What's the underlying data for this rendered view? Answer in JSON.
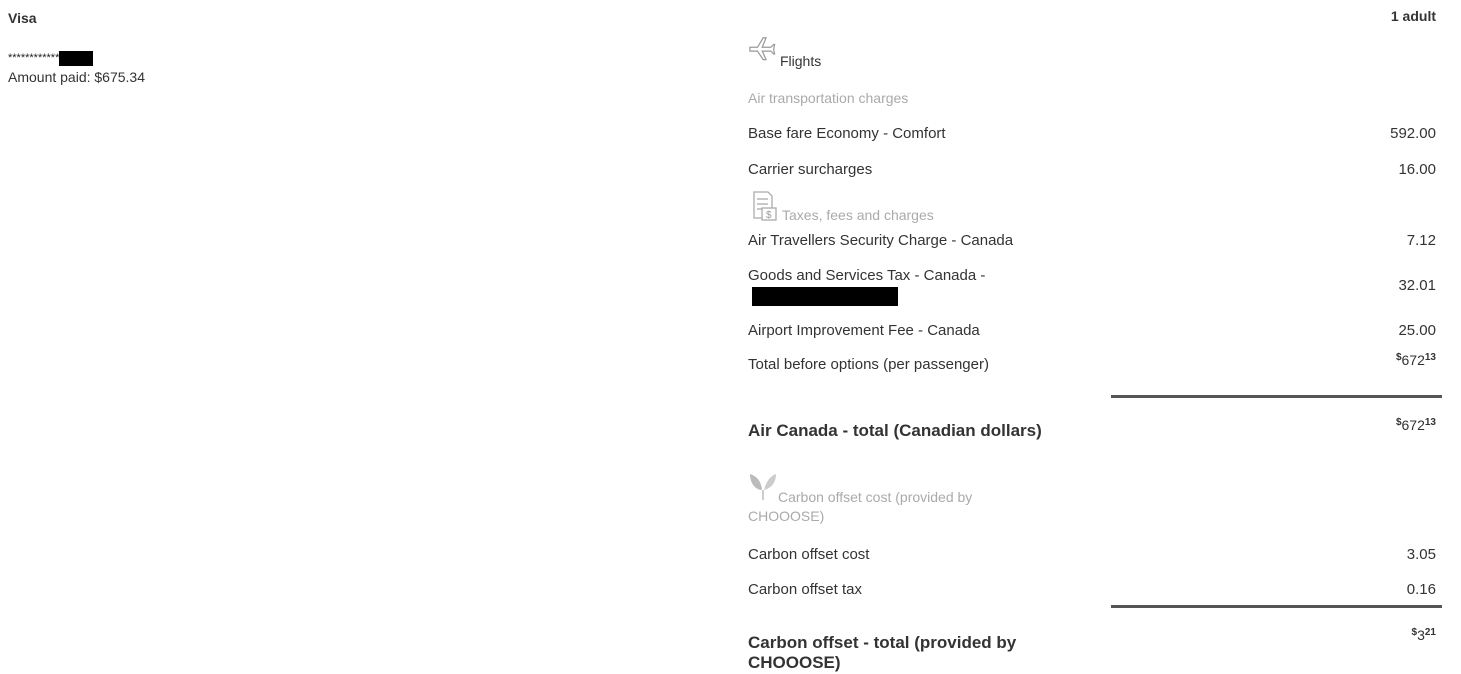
{
  "payment": {
    "method": "Visa",
    "card_mask": "************",
    "amount_label": "Amount paid:",
    "amount_value": "$675.34"
  },
  "fare": {
    "passengers": "1 adult",
    "flights_label": "Flights",
    "air_transport_label": "Air transportation charges",
    "base_fare_label": "Base fare Economy - Comfort",
    "base_fare_value": "592.00",
    "carrier_label": "Carrier surcharges",
    "carrier_value": "16.00",
    "taxes_label": "Taxes, fees and charges",
    "atsc_label": "Air Travellers Security Charge - Canada",
    "atsc_value": "7.12",
    "gst_label": "Goods and Services Tax - Canada -",
    "gst_value": "32.01",
    "aif_label": "Airport Improvement Fee - Canada",
    "aif_value": "25.00",
    "total_before_label": "Total before options (per passenger)",
    "total_before": {
      "symbol": "$",
      "whole": "672",
      "cents": "13"
    },
    "air_canada_total_label": "Air Canada - total (Canadian dollars)",
    "air_canada_total": {
      "symbol": "$",
      "whole": "672",
      "cents": "13"
    },
    "carbon_head_label": "Carbon offset cost (provided by CHOOOSE)",
    "carbon_cost_label": "Carbon offset cost",
    "carbon_cost_value": "3.05",
    "carbon_tax_label": "Carbon offset tax",
    "carbon_tax_value": "0.16",
    "carbon_total_label": "Carbon offset - total (provided by CHOOOSE)",
    "carbon_total": {
      "symbol": "$",
      "whole": "3",
      "cents": "21"
    }
  },
  "icons": {
    "flights": "airplane-icon",
    "taxes": "receipt-icon",
    "carbon": "leaf-icon"
  }
}
